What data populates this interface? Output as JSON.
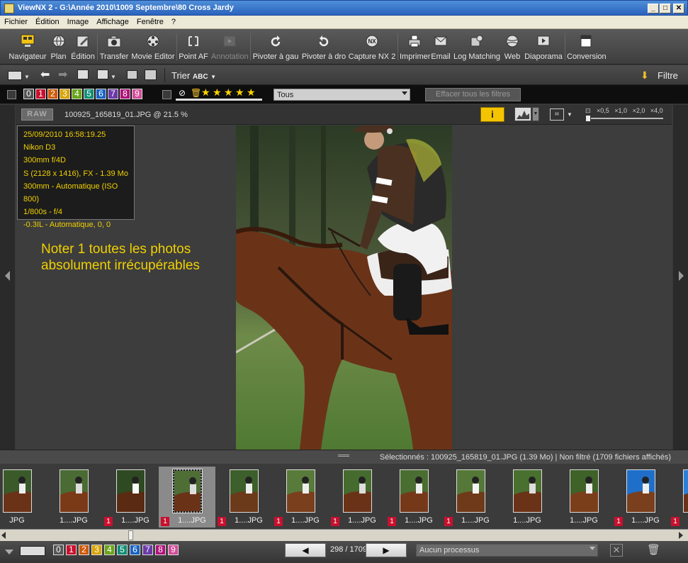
{
  "window": {
    "title": "ViewNX 2 - G:\\Année 2010\\1009 Septembre\\80 Cross Jardy"
  },
  "menu": [
    "Fichier",
    "Édition",
    "Image",
    "Affichage",
    "Fenêtre",
    "?"
  ],
  "toolbar": {
    "items": [
      {
        "label": "Navigateur",
        "icon": "navigator-icon"
      },
      {
        "label": "Plan",
        "icon": "globe-icon"
      },
      {
        "label": "Édition",
        "icon": "edit-icon"
      },
      {
        "label": "Transfer",
        "icon": "camera-transfer-icon"
      },
      {
        "label": "Movie Editor",
        "icon": "film-reel-icon"
      },
      {
        "label": "Point AF",
        "icon": "af-point-icon"
      },
      {
        "label": "Annotation",
        "icon": "annotation-icon"
      },
      {
        "label": "Pivoter à gau",
        "icon": "rotate-left-icon"
      },
      {
        "label": "Pivoter à dro",
        "icon": "rotate-right-icon"
      },
      {
        "label": "Capture NX 2",
        "icon": "capture-nx-icon"
      },
      {
        "label": "Imprimer",
        "icon": "printer-icon"
      },
      {
        "label": "Email",
        "icon": "email-icon"
      },
      {
        "label": "Log Matching",
        "icon": "log-matching-icon"
      },
      {
        "label": "Web",
        "icon": "web-icon"
      },
      {
        "label": "Diaporama",
        "icon": "slideshow-icon"
      },
      {
        "label": "Conversion",
        "icon": "conversion-icon"
      }
    ],
    "capture_icon_text": "NX"
  },
  "bar2": {
    "sort_label": "Trier",
    "sort_glyph": "ABC",
    "filter_label": "Filtre"
  },
  "filterbar": {
    "labels": [
      "0",
      "1",
      "2",
      "3",
      "4",
      "5",
      "6",
      "7",
      "8",
      "9"
    ],
    "label_colors": [
      "#555555",
      "#c8102e",
      "#d05a0a",
      "#d8a300",
      "#6aa51a",
      "#138f76",
      "#1a63c2",
      "#6c3aa8",
      "#b0127a",
      "#d24e9a"
    ],
    "rating_dropdown": "Tous",
    "clear_button": "Effacer tous les filtres"
  },
  "infobar": {
    "raw_badge": "RAW",
    "file_title": "100925_165819_01.JPG @ 21.5 %",
    "info_button": "i",
    "zoom_levels": [
      "×0,5",
      "×1,0",
      "×2,0",
      "×4,0"
    ]
  },
  "metadata": [
    "25/09/2010 16:58:19.25",
    "Nikon D3",
    "300mm f/4D",
    "S (2128 x 1416), FX - 1.39 Mo",
    "300mm - Automatique (ISO 800)",
    "1/800s - f/4",
    "-0.3IL - Automatique, 0, 0"
  ],
  "note": {
    "line1": "Noter 1 toutes les photos",
    "line2": "absolument irrécupérables"
  },
  "statusbar": {
    "text": "Sélectionnés : 100925_165819_01.JPG (1.39 Mo) | Non filtré  (1709 fichiers affichés)"
  },
  "filmstrip": {
    "items": [
      {
        "label": "JPG",
        "rating": ""
      },
      {
        "label": "1....JPG",
        "rating": ""
      },
      {
        "label": "1....JPG",
        "rating": "1"
      },
      {
        "label": "1....JPG",
        "rating": "1",
        "selected": true
      },
      {
        "label": "1....JPG",
        "rating": "1"
      },
      {
        "label": "1....JPG",
        "rating": "1"
      },
      {
        "label": "1....JPG",
        "rating": "1"
      },
      {
        "label": "1....JPG",
        "rating": "1"
      },
      {
        "label": "1....JPG",
        "rating": "1"
      },
      {
        "label": "1....JPG",
        "rating": ""
      },
      {
        "label": "1....JPG",
        "rating": ""
      },
      {
        "label": "1....JPG",
        "rating": "1"
      },
      {
        "label": "1.",
        "rating": "1"
      }
    ]
  },
  "bottombar": {
    "labels": [
      "0",
      "1",
      "2",
      "3",
      "4",
      "5",
      "6",
      "7",
      "8",
      "9"
    ],
    "page_counter": "298 / 1709",
    "process_dropdown": "Aucun processus"
  }
}
